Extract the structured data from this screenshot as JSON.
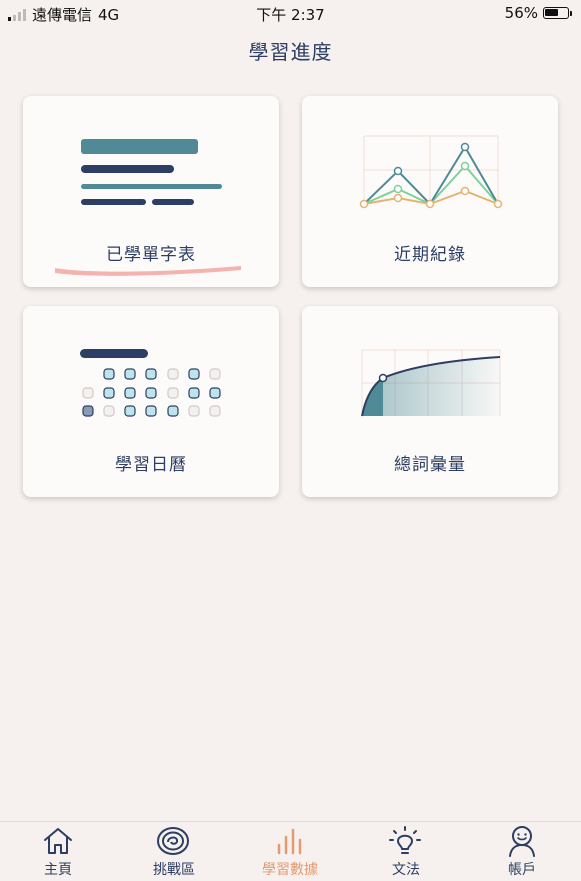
{
  "status_bar": {
    "carrier": "遠傳電信",
    "network": "4G",
    "time": "下午 2:37",
    "battery": "56%"
  },
  "page_title": "學習進度",
  "cards": [
    {
      "label": "已學單字表",
      "icon": "word-list-icon"
    },
    {
      "label": "近期紀錄",
      "icon": "line-chart-icon"
    },
    {
      "label": "學習日曆",
      "icon": "calendar-grid-icon"
    },
    {
      "label": "總詞彙量",
      "icon": "growth-curve-icon"
    }
  ],
  "tabbar": {
    "items": [
      {
        "label": "主頁",
        "icon": "home-icon"
      },
      {
        "label": "挑戰區",
        "icon": "challenge-icon"
      },
      {
        "label": "學習數據",
        "icon": "bar-chart-icon",
        "active": true
      },
      {
        "label": "文法",
        "icon": "lightbulb-icon"
      },
      {
        "label": "帳戶",
        "icon": "user-icon"
      }
    ],
    "active_color": "#e49a72",
    "color": "#2c3e63"
  },
  "colors": {
    "navy": "#2c3e63",
    "teal": "#4f8a96",
    "green": "#7fd19b",
    "gold": "#e3b46f",
    "highlight": "#f3a6a1"
  }
}
